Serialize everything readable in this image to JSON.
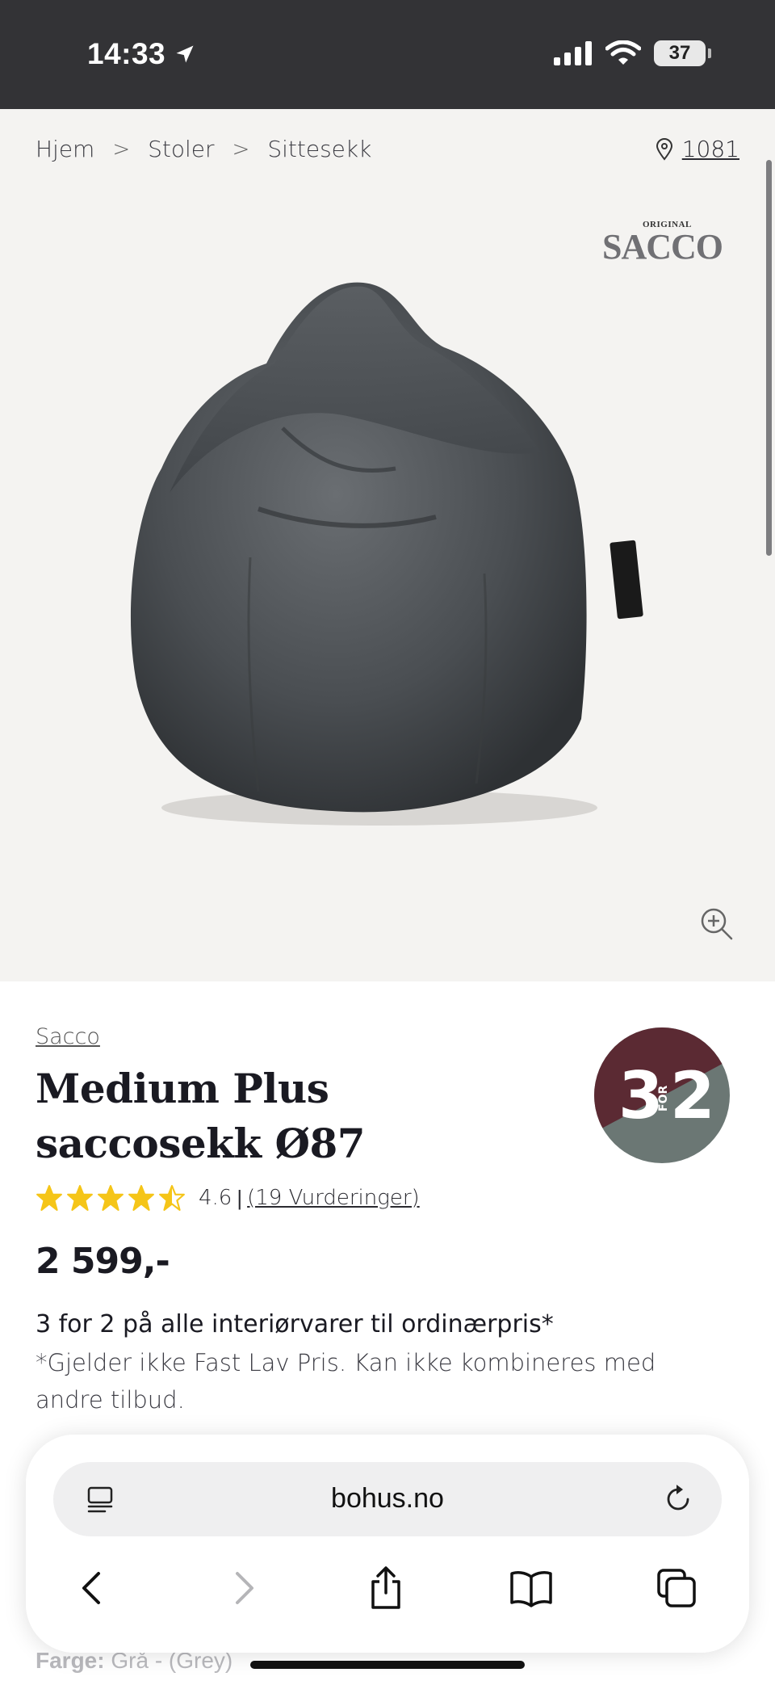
{
  "status_bar": {
    "time": "14:33",
    "battery": "37"
  },
  "breadcrumb": {
    "items": [
      "Hjem",
      "Stoler",
      "Sittesekk"
    ],
    "separator": ">"
  },
  "location": {
    "store_code": "1081"
  },
  "brand_logo": {
    "small_text": "ORIGINAL",
    "big_text": "SACCO"
  },
  "product": {
    "brand": "Sacco",
    "title": "Medium Plus saccosekk Ø87",
    "rating": 4.6,
    "rating_score": "4.6",
    "rating_separator": "|",
    "rating_count": "(19 Vurderinger)",
    "price": "2 599,-",
    "offer_heading": "3 for 2 på alle interiørvarer til ordinærpris*",
    "offer_note": "*Gjelder ikke Fast Lav Pris. Kan ikke kombineres med andre tilbud.",
    "color_label": "Farge:",
    "color_value": "Grå - (Grey)"
  },
  "promo_badge": {
    "left": "3",
    "middle": "FOR",
    "right": "2",
    "colors": {
      "top": "#5b2a33",
      "bottom": "#6b7774"
    }
  },
  "browser": {
    "url": "bohus.no",
    "icons": [
      "page-menu-icon",
      "reload-icon",
      "back-icon",
      "forward-icon",
      "share-icon",
      "bookmarks-icon",
      "tabs-icon"
    ]
  },
  "colors": {
    "status_bar_bg": "#333336",
    "hero_bg": "#f4f3f1",
    "star": "#f5c518",
    "text_dark": "#1a1a22"
  }
}
